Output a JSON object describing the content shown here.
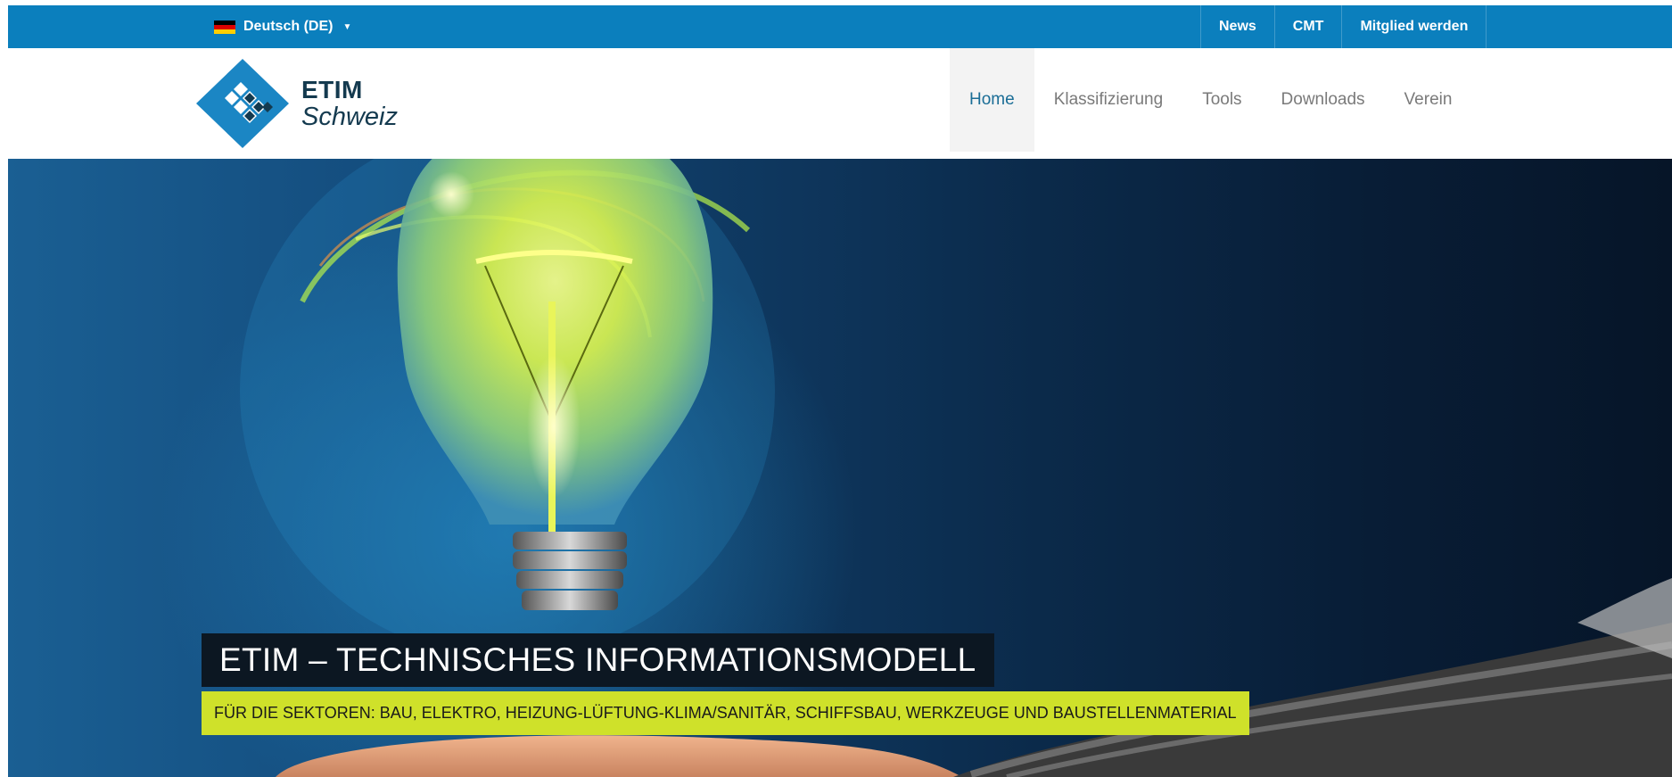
{
  "topbar": {
    "language": {
      "label": "Deutsch (DE)",
      "flag_icon": "german-flag-icon",
      "caret_icon": "caret-down-icon"
    },
    "links": [
      {
        "label": "News"
      },
      {
        "label": "CMT"
      },
      {
        "label": "Mitglied werden"
      }
    ],
    "color": "#0b7fbd"
  },
  "header": {
    "logo": {
      "line1": "ETIM",
      "line2": "Schweiz",
      "icon": "etim-diamond-logo"
    },
    "nav": [
      {
        "label": "Home",
        "active": true
      },
      {
        "label": "Klassifizierung",
        "active": false
      },
      {
        "label": "Tools",
        "active": false
      },
      {
        "label": "Downloads",
        "active": false
      },
      {
        "label": "Verein",
        "active": false
      }
    ]
  },
  "hero": {
    "image": "light-bulb-on-hand",
    "title": "ETIM – TECHNISCHES INFORMATIONSMODELL",
    "subtitle": "FÜR DIE SEKTOREN: BAU, ELEKTRO, HEIZUNG-LÜFTUNG-KLIMA/SANITÄR, SCHIFFSBAU, WERKZEUGE UND BAUSTELLENMATERIAL",
    "accent_color": "#cfe12a"
  }
}
